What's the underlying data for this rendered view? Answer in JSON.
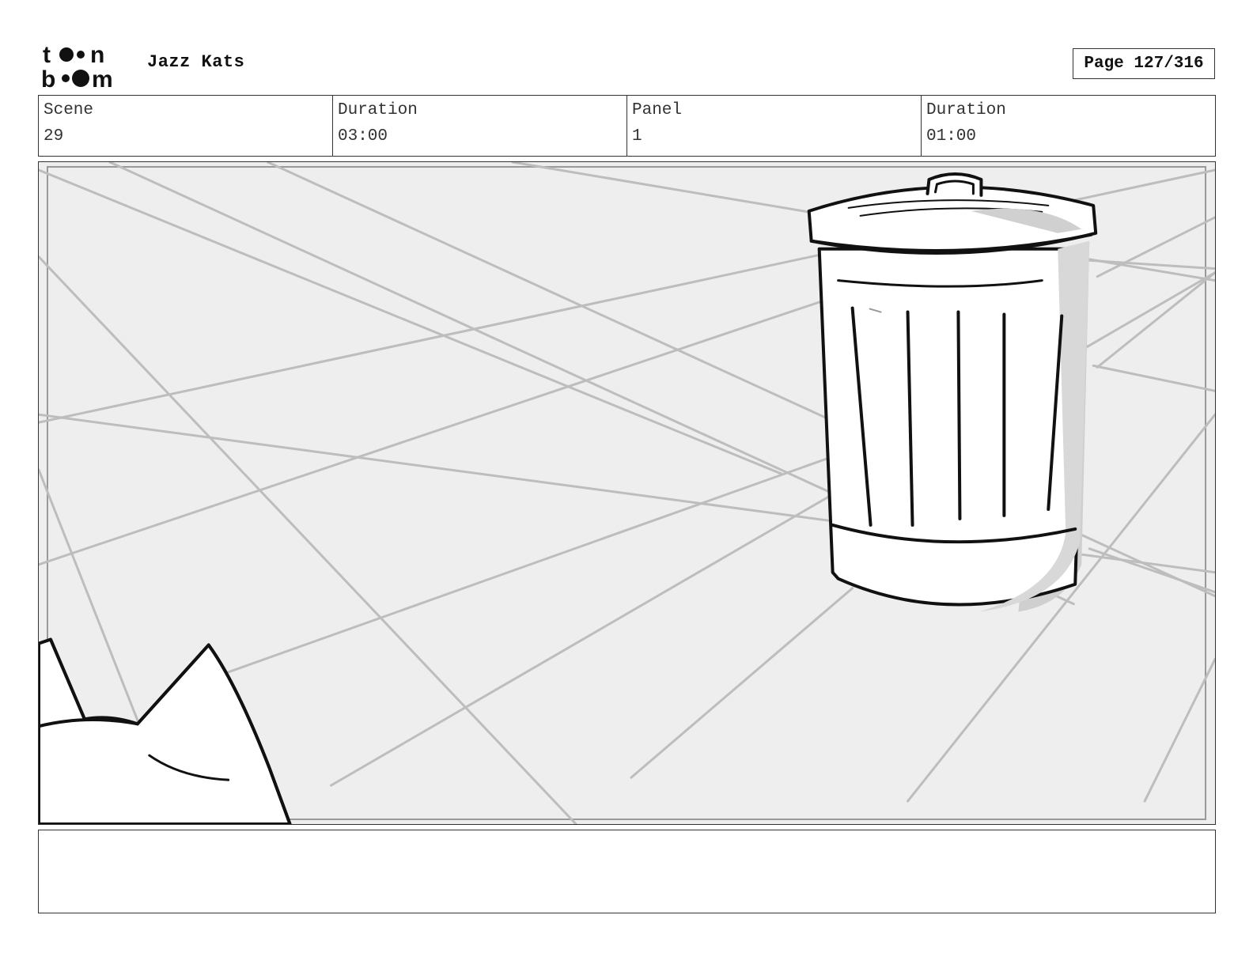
{
  "header": {
    "logo_icon": "toonboom-logo",
    "project_title": "Jazz Kats",
    "page_label": "Page 127/316"
  },
  "info": {
    "scene_label": "Scene",
    "scene_value": "29",
    "scene_duration_label": "Duration",
    "scene_duration_value": "03:00",
    "panel_label": "Panel",
    "panel_value": "1",
    "panel_duration_label": "Duration",
    "panel_duration_value": "01:00"
  },
  "panel": {
    "image_icon": "storyboard-sketch-trash-can-and-cat-ears"
  },
  "notes": {
    "text": ""
  }
}
